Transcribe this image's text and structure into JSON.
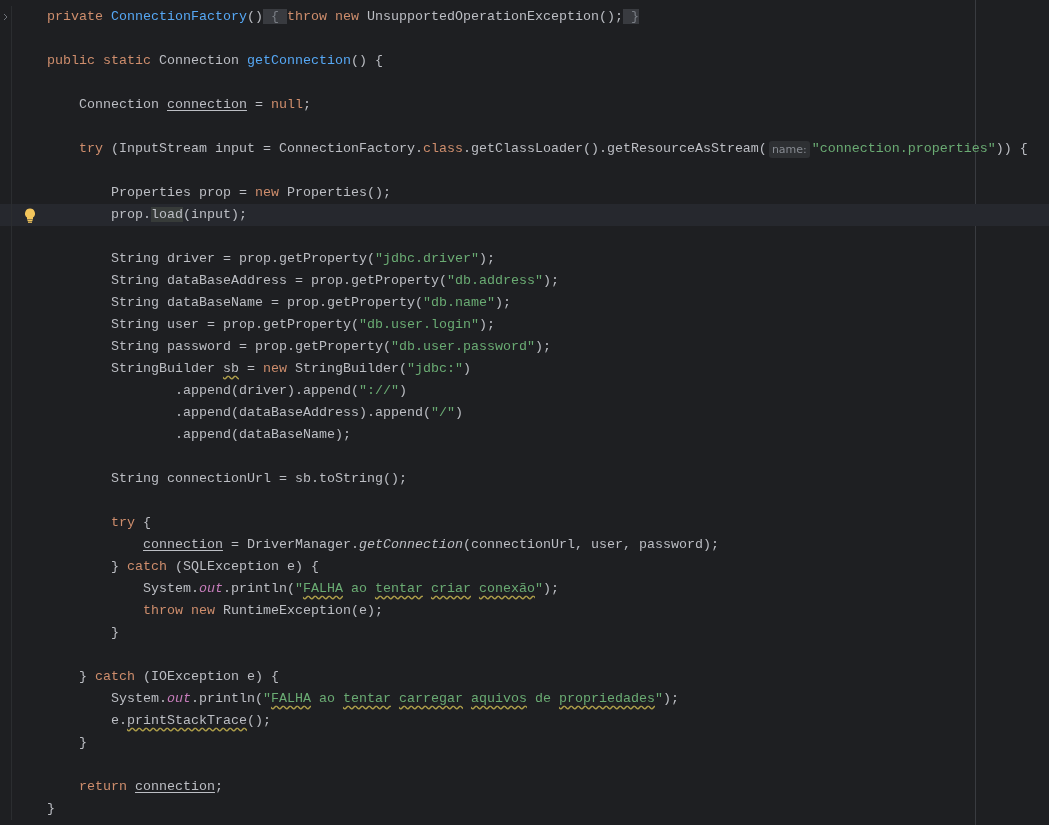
{
  "lines": [
    {
      "kind": "code",
      "current": false,
      "gutter": {
        "kind": "fold-arrow"
      },
      "tokens": [
        {
          "text": "private ",
          "kind": "keyword"
        },
        {
          "text": "ConnectionFactory",
          "kind": "declaration"
        },
        {
          "text": "()",
          "kind": "plain"
        },
        {
          "text": " { ",
          "kind": "fold-brace"
        },
        {
          "text": "throw new ",
          "kind": "keyword"
        },
        {
          "text": "UnsupportedOperationException();",
          "kind": "plain"
        },
        {
          "text": " }",
          "kind": "fold-brace"
        }
      ]
    },
    {
      "kind": "blank",
      "current": false
    },
    {
      "kind": "code",
      "current": false,
      "tokens": [
        {
          "text": "public static ",
          "kind": "keyword"
        },
        {
          "text": "Connection ",
          "kind": "plain"
        },
        {
          "text": "getConnection",
          "kind": "declaration"
        },
        {
          "text": "() {",
          "kind": "plain"
        }
      ]
    },
    {
      "kind": "blank",
      "current": false
    },
    {
      "kind": "code",
      "current": false,
      "tokens": [
        {
          "text": "    Connection ",
          "kind": "plain"
        },
        {
          "text": "connection",
          "kind": "reassigned-variable"
        },
        {
          "text": " = ",
          "kind": "plain"
        },
        {
          "text": "null",
          "kind": "keyword"
        },
        {
          "text": ";",
          "kind": "plain"
        }
      ]
    },
    {
      "kind": "blank",
      "current": false
    },
    {
      "kind": "code",
      "current": false,
      "tokens": [
        {
          "text": "    try",
          "kind": "keyword"
        },
        {
          "text": " (InputStream input = ConnectionFactory.",
          "kind": "plain"
        },
        {
          "text": "class",
          "kind": "keyword"
        },
        {
          "text": ".getClassLoader().getResourceAsStream(",
          "kind": "plain"
        },
        {
          "text": "name:",
          "kind": "hint"
        },
        {
          "text": "\"connection.properties\"",
          "kind": "string"
        },
        {
          "text": ")) {",
          "kind": "plain"
        }
      ]
    },
    {
      "kind": "blank",
      "current": false
    },
    {
      "kind": "code",
      "current": false,
      "tokens": [
        {
          "text": "        Properties prop = ",
          "kind": "plain"
        },
        {
          "text": "new",
          "kind": "keyword"
        },
        {
          "text": " Properties();",
          "kind": "plain"
        }
      ]
    },
    {
      "kind": "code",
      "current": true,
      "gutter": {
        "kind": "bulb"
      },
      "tokens": [
        {
          "text": "        prop.",
          "kind": "plain"
        },
        {
          "text": "load",
          "kind": "usage-highlight"
        },
        {
          "text": "(input);",
          "kind": "plain"
        }
      ]
    },
    {
      "kind": "blank",
      "current": false
    },
    {
      "kind": "code",
      "current": false,
      "tokens": [
        {
          "text": "        String driver = prop.getProperty(",
          "kind": "plain"
        },
        {
          "text": "\"jdbc.driver\"",
          "kind": "string"
        },
        {
          "text": ");",
          "kind": "plain"
        }
      ]
    },
    {
      "kind": "code",
      "current": false,
      "tokens": [
        {
          "text": "        String dataBaseAddress = prop.getProperty(",
          "kind": "plain"
        },
        {
          "text": "\"db.address\"",
          "kind": "string"
        },
        {
          "text": ");",
          "kind": "plain"
        }
      ]
    },
    {
      "kind": "code",
      "current": false,
      "tokens": [
        {
          "text": "        String dataBaseName = prop.getProperty(",
          "kind": "plain"
        },
        {
          "text": "\"db.name\"",
          "kind": "string"
        },
        {
          "text": ");",
          "kind": "plain"
        }
      ]
    },
    {
      "kind": "code",
      "current": false,
      "tokens": [
        {
          "text": "        String user = prop.getProperty(",
          "kind": "plain"
        },
        {
          "text": "\"db.user.login\"",
          "kind": "string"
        },
        {
          "text": ");",
          "kind": "plain"
        }
      ]
    },
    {
      "kind": "code",
      "current": false,
      "tokens": [
        {
          "text": "        String password = prop.getProperty(",
          "kind": "plain"
        },
        {
          "text": "\"db.user.password\"",
          "kind": "string"
        },
        {
          "text": ");",
          "kind": "plain"
        }
      ]
    },
    {
      "kind": "code",
      "current": false,
      "tokens": [
        {
          "text": "        StringBuilder ",
          "kind": "plain"
        },
        {
          "text": "sb",
          "kind": "plain-warning"
        },
        {
          "text": " = ",
          "kind": "plain"
        },
        {
          "text": "new",
          "kind": "keyword"
        },
        {
          "text": " StringBuilder(",
          "kind": "plain"
        },
        {
          "text": "\"jdbc:\"",
          "kind": "string"
        },
        {
          "text": ")",
          "kind": "plain"
        }
      ]
    },
    {
      "kind": "code",
      "current": false,
      "tokens": [
        {
          "text": "                .append(driver).append(",
          "kind": "plain"
        },
        {
          "text": "\"://\"",
          "kind": "string"
        },
        {
          "text": ")",
          "kind": "plain"
        }
      ]
    },
    {
      "kind": "code",
      "current": false,
      "tokens": [
        {
          "text": "                .append(dataBaseAddress).append(",
          "kind": "plain"
        },
        {
          "text": "\"/\"",
          "kind": "string"
        },
        {
          "text": ")",
          "kind": "plain"
        }
      ]
    },
    {
      "kind": "code",
      "current": false,
      "tokens": [
        {
          "text": "                .append(dataBaseName);",
          "kind": "plain"
        }
      ]
    },
    {
      "kind": "blank",
      "current": false
    },
    {
      "kind": "code",
      "current": false,
      "tokens": [
        {
          "text": "        String connectionUrl = sb.toString();",
          "kind": "plain"
        }
      ]
    },
    {
      "kind": "blank",
      "current": false
    },
    {
      "kind": "code",
      "current": false,
      "tokens": [
        {
          "text": "        try",
          "kind": "keyword"
        },
        {
          "text": " {",
          "kind": "plain"
        }
      ]
    },
    {
      "kind": "code",
      "current": false,
      "tokens": [
        {
          "text": "            connection",
          "kind": "reassigned-variable"
        },
        {
          "text": " = DriverManager.",
          "kind": "plain"
        },
        {
          "text": "getConnection",
          "kind": "static-call"
        },
        {
          "text": "(connectionUrl, user, password);",
          "kind": "plain"
        }
      ]
    },
    {
      "kind": "code",
      "current": false,
      "tokens": [
        {
          "text": "        } ",
          "kind": "plain"
        },
        {
          "text": "catch",
          "kind": "keyword"
        },
        {
          "text": " (SQLException e) {",
          "kind": "plain"
        }
      ]
    },
    {
      "kind": "code",
      "current": false,
      "tokens": [
        {
          "text": "            System.",
          "kind": "plain"
        },
        {
          "text": "out",
          "kind": "field"
        },
        {
          "text": ".println(",
          "kind": "plain"
        },
        {
          "text": "\"",
          "kind": "string"
        },
        {
          "text": "FALHA",
          "kind": "string-typo"
        },
        {
          "text": " ao ",
          "kind": "string"
        },
        {
          "text": "tentar ",
          "kind": "string-typo"
        },
        {
          "text": "criar ",
          "kind": "string-typo"
        },
        {
          "text": "conexão",
          "kind": "string-typo"
        },
        {
          "text": "\"",
          "kind": "string"
        },
        {
          "text": ");",
          "kind": "plain"
        }
      ]
    },
    {
      "kind": "code",
      "current": false,
      "tokens": [
        {
          "text": "            throw new",
          "kind": "keyword"
        },
        {
          "text": " RuntimeException(e);",
          "kind": "plain"
        }
      ]
    },
    {
      "kind": "code",
      "current": false,
      "tokens": [
        {
          "text": "        }",
          "kind": "plain"
        }
      ]
    },
    {
      "kind": "blank",
      "current": false
    },
    {
      "kind": "code",
      "current": false,
      "tokens": [
        {
          "text": "    } ",
          "kind": "plain"
        },
        {
          "text": "catch",
          "kind": "keyword"
        },
        {
          "text": " (IOException e) {",
          "kind": "plain"
        }
      ]
    },
    {
      "kind": "code",
      "current": false,
      "tokens": [
        {
          "text": "        System.",
          "kind": "plain"
        },
        {
          "text": "out",
          "kind": "field"
        },
        {
          "text": ".println(",
          "kind": "plain"
        },
        {
          "text": "\"",
          "kind": "string"
        },
        {
          "text": "FALHA",
          "kind": "string-typo"
        },
        {
          "text": " ao ",
          "kind": "string"
        },
        {
          "text": "tentar ",
          "kind": "string-typo"
        },
        {
          "text": "carregar ",
          "kind": "string-typo"
        },
        {
          "text": "aquivos",
          "kind": "string-typo"
        },
        {
          "text": " de ",
          "kind": "string"
        },
        {
          "text": "propriedades",
          "kind": "string-typo"
        },
        {
          "text": "\"",
          "kind": "string"
        },
        {
          "text": ");",
          "kind": "plain"
        }
      ]
    },
    {
      "kind": "code",
      "current": false,
      "tokens": [
        {
          "text": "        e.",
          "kind": "plain"
        },
        {
          "text": "printStackTrace",
          "kind": "plain-warning"
        },
        {
          "text": "();",
          "kind": "plain"
        }
      ]
    },
    {
      "kind": "code",
      "current": false,
      "tokens": [
        {
          "text": "    }",
          "kind": "plain"
        }
      ]
    },
    {
      "kind": "blank",
      "current": false
    },
    {
      "kind": "code",
      "current": false,
      "tokens": [
        {
          "text": "    return",
          "kind": "keyword"
        },
        {
          "text": " connection",
          "kind": "reassigned-variable"
        },
        {
          "text": ";",
          "kind": "plain"
        }
      ]
    },
    {
      "kind": "code",
      "current": false,
      "tokens": [
        {
          "text": "}",
          "kind": "plain"
        }
      ]
    }
  ]
}
